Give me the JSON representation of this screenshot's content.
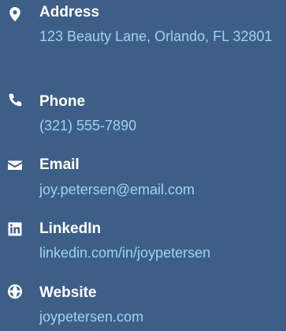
{
  "contacts": [
    {
      "icon": "map-marker-icon",
      "label": "Address",
      "value": "123 Beauty Lane, Orlando, FL 32801"
    },
    {
      "icon": "phone-icon",
      "label": "Phone",
      "value": "(321) 555-7890"
    },
    {
      "icon": "envelope-icon",
      "label": "Email",
      "value": "joy.petersen@email.com"
    },
    {
      "icon": "linkedin-icon",
      "label": "LinkedIn",
      "value": "linkedin.com/in/joypetersen"
    },
    {
      "icon": "globe-icon",
      "label": "Website",
      "value": "joypetersen.com"
    }
  ],
  "colors": {
    "background": "#3d5f87",
    "label": "#ffffff",
    "value": "#9fd3f0"
  }
}
